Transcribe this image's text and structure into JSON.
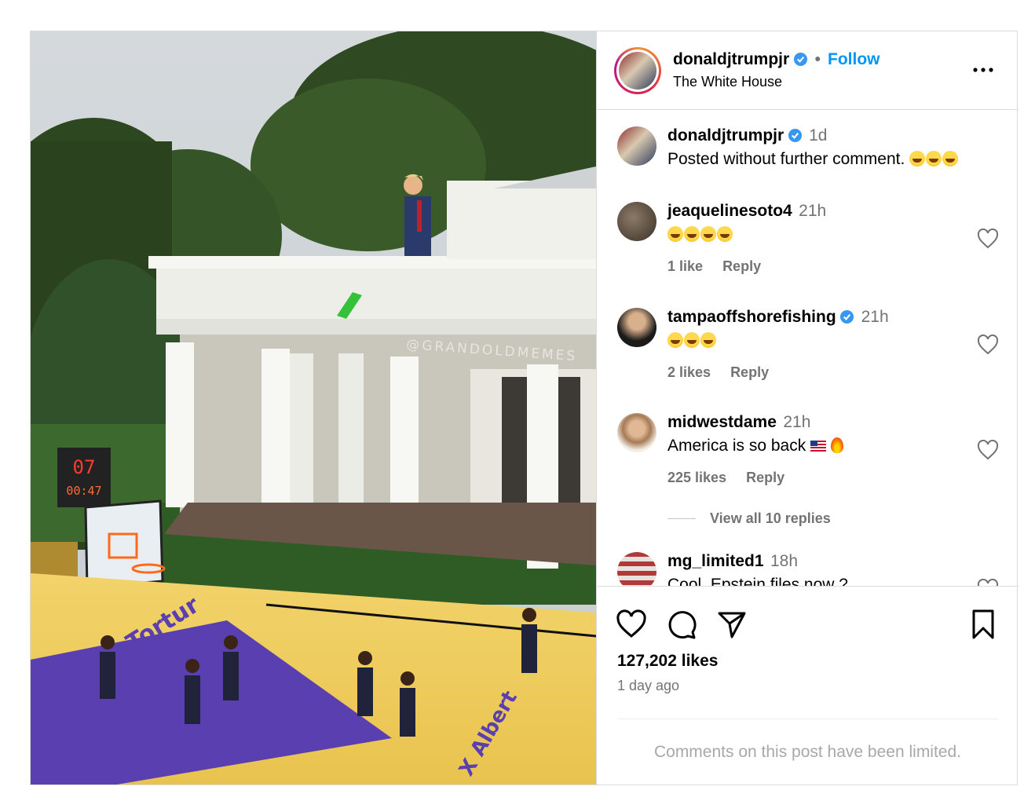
{
  "header": {
    "username": "donaldjtrumpjr",
    "verified": true,
    "follow_label": "Follow",
    "location": "The White House",
    "more_icon": "more-horizontal-icon"
  },
  "media": {
    "watermark": "@GRANDOLDMEMES",
    "scoreboard_top": "07",
    "scoreboard_bottom": "00:47",
    "court_text_left": "Tortur",
    "court_text_right": "X Albert"
  },
  "comments": [
    {
      "username": "donaldjtrumpjr",
      "verified": true,
      "time": "1d",
      "text": "Posted without further comment.",
      "emoji_count": 3
    },
    {
      "username": "jeaquelinesoto4",
      "verified": false,
      "time": "21h",
      "emoji_count": 4,
      "likes": "1 like",
      "reply": "Reply"
    },
    {
      "username": "tampaoffshorefishing",
      "verified": true,
      "time": "21h",
      "emoji_count": 3,
      "likes": "2 likes",
      "reply": "Reply"
    },
    {
      "username": "midwestdame",
      "verified": false,
      "time": "21h",
      "text": "America is so back",
      "likes": "225 likes",
      "reply": "Reply"
    },
    {
      "username": "mg_limited1",
      "verified": false,
      "time": "18h",
      "text": "Cool. Epstein files now ?"
    }
  ],
  "view_replies": "View all 10 replies",
  "actions": {
    "icons": [
      "heart-icon",
      "comment-icon",
      "share-icon",
      "bookmark-icon"
    ],
    "likes": "127,202 likes",
    "time_ago": "1 day ago"
  },
  "limited_notice": "Comments on this post have been limited.",
  "colors": {
    "link": "#0095f6",
    "muted": "#737373",
    "verified": "#3897f0"
  }
}
